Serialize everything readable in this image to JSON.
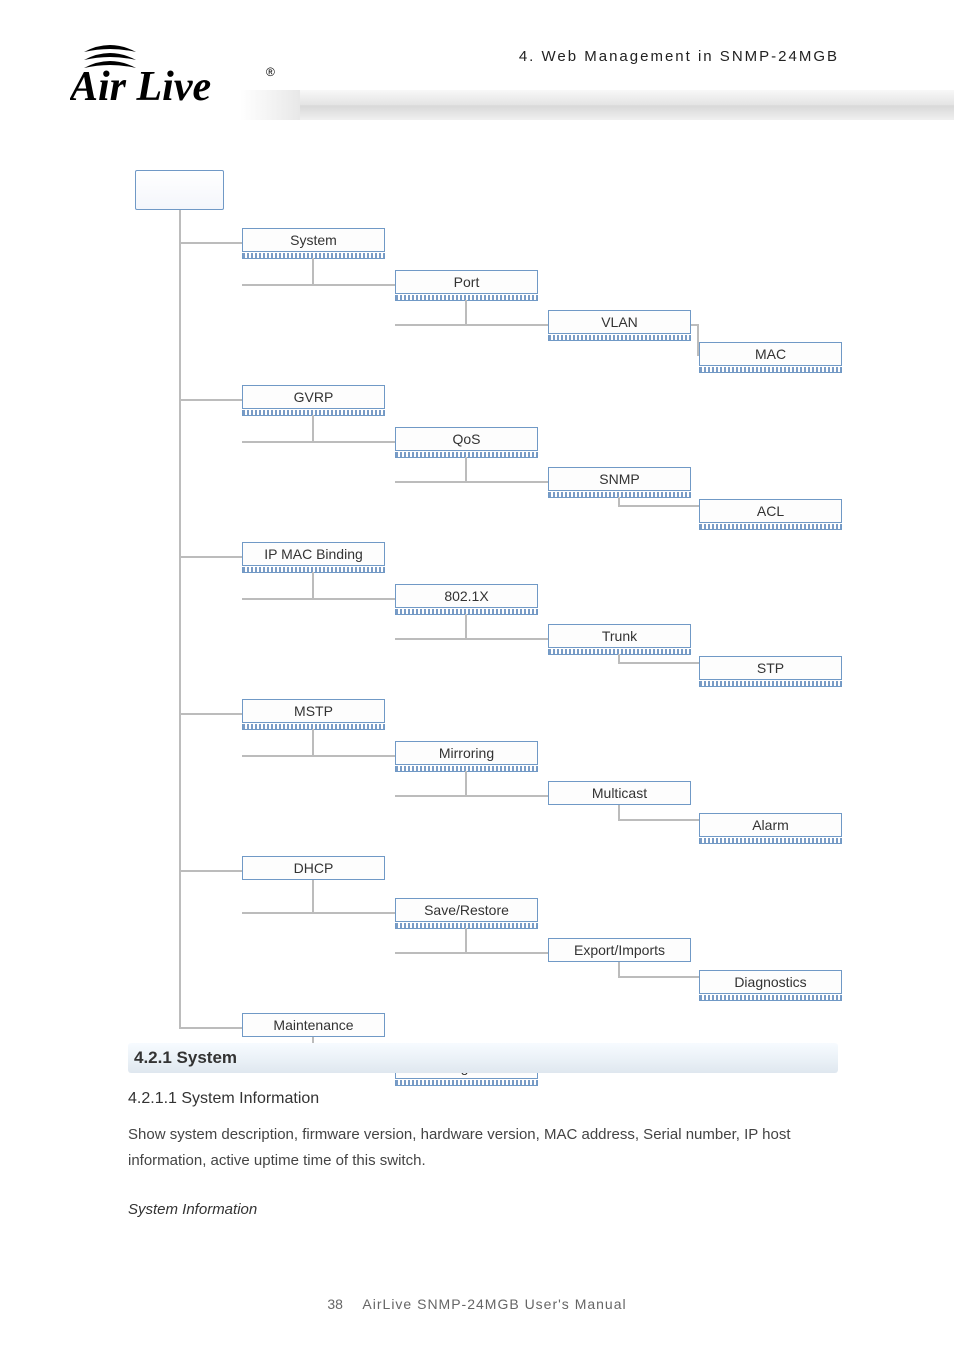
{
  "header": {
    "chapter": "4.  Web  Management  in  SNMP-24MGB"
  },
  "logo": {
    "brand": "Air Live",
    "mark": "®"
  },
  "tree": {
    "root": "",
    "nodes": [
      {
        "id": "system",
        "label": "System"
      },
      {
        "id": "port",
        "label": "Port"
      },
      {
        "id": "vlan",
        "label": "VLAN"
      },
      {
        "id": "mac",
        "label": "MAC"
      },
      {
        "id": "gvrp",
        "label": "GVRP"
      },
      {
        "id": "qos",
        "label": "QoS"
      },
      {
        "id": "snmp",
        "label": "SNMP"
      },
      {
        "id": "acl",
        "label": "ACL"
      },
      {
        "id": "ipmac",
        "label": "IP MAC Binding"
      },
      {
        "id": "8021x",
        "label": "802.1X"
      },
      {
        "id": "trunk",
        "label": "Trunk"
      },
      {
        "id": "stp",
        "label": "STP"
      },
      {
        "id": "mstp",
        "label": "MSTP"
      },
      {
        "id": "mirror",
        "label": "Mirroring"
      },
      {
        "id": "mcast",
        "label": "Multicast"
      },
      {
        "id": "alarm",
        "label": "Alarm"
      },
      {
        "id": "dhcp",
        "label": "DHCP"
      },
      {
        "id": "saverest",
        "label": "Save/Restore"
      },
      {
        "id": "expimp",
        "label": "Export/Imports"
      },
      {
        "id": "diag",
        "label": "Diagnostics"
      },
      {
        "id": "maint",
        "label": "Maintenance"
      },
      {
        "id": "logout",
        "label": "Logout"
      }
    ]
  },
  "section": {
    "title": "4.2.1 System"
  },
  "body": {
    "heading": "4.2.1.1 System Information",
    "paragraph": "Show system description, firmware version, hardware version, MAC address, Serial number, IP host information, active uptime time of this switch.",
    "controlLabel": "System Information"
  },
  "footer": {
    "page": "38",
    "label": "AirLive SNMP-24MGB User's Manual"
  }
}
